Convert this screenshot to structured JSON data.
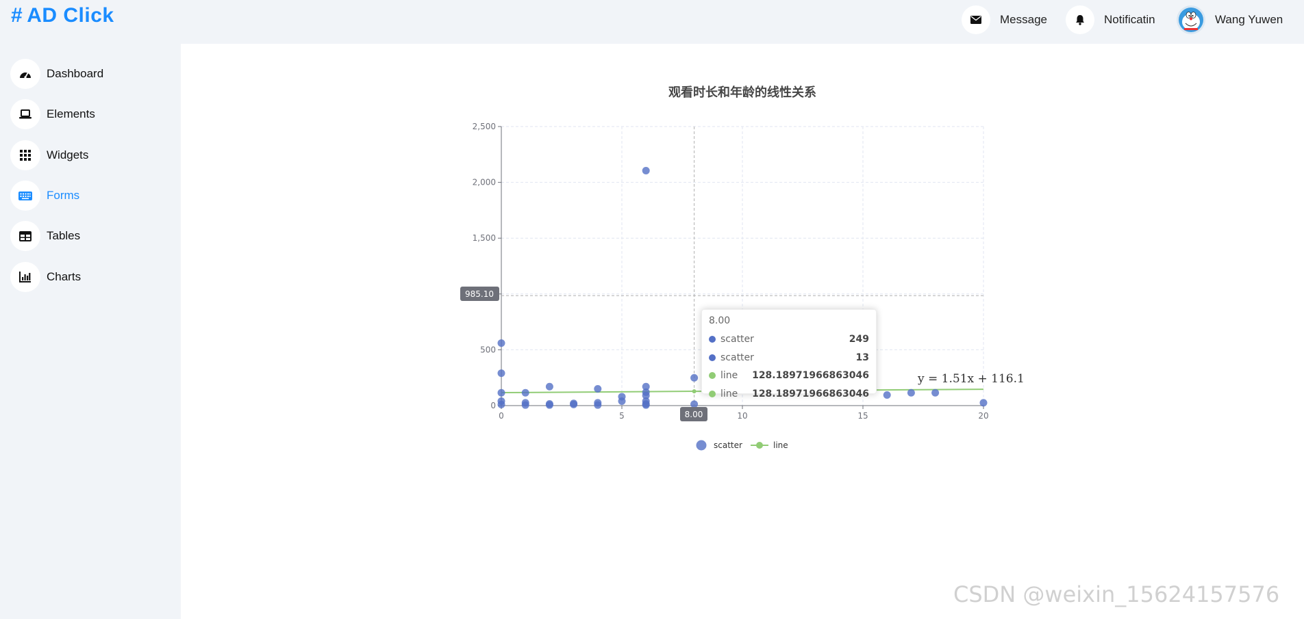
{
  "app": {
    "logo_text": "AD Click",
    "logo_hash": "#"
  },
  "header": {
    "message_label": "Message",
    "notification_label": "Notificatin",
    "user_name": "Wang Yuwen",
    "icons": {
      "message": "envelope-icon",
      "notification": "bell-icon",
      "avatar": "doraemon-avatar"
    }
  },
  "sidebar": {
    "items": [
      {
        "label": "Dashboard",
        "icon": "gauge-icon",
        "active": false
      },
      {
        "label": "Elements",
        "icon": "laptop-icon",
        "active": false
      },
      {
        "label": "Widgets",
        "icon": "grid-icon",
        "active": false
      },
      {
        "label": "Forms",
        "icon": "keyboard-icon",
        "active": true
      },
      {
        "label": "Tables",
        "icon": "table-icon",
        "active": false
      },
      {
        "label": "Charts",
        "icon": "bar-chart-icon",
        "active": false
      }
    ]
  },
  "colors": {
    "accent": "#1a8cff",
    "scatter": "#5470c6",
    "line": "#91cc75"
  },
  "chart_data": {
    "type": "scatter",
    "title": "观看时长和年龄的线性关系",
    "xlim": [
      0,
      20
    ],
    "ylim": [
      0,
      2500
    ],
    "x_ticks": [
      "0",
      "5",
      "10",
      "15",
      "20"
    ],
    "y_ticks": [
      "0",
      "500",
      "1,000",
      "1,500",
      "2,000",
      "2,500"
    ],
    "legend": [
      "scatter",
      "line"
    ],
    "legend_position": "bottom-center",
    "grid": true,
    "regression_label": "y = 1.51x + 116.1",
    "series": [
      {
        "name": "scatter",
        "type": "scatter",
        "points": [
          [
            0,
            560
          ],
          [
            0,
            290
          ],
          [
            0,
            115
          ],
          [
            0,
            40
          ],
          [
            0,
            10
          ],
          [
            1,
            115
          ],
          [
            1,
            25
          ],
          [
            1,
            5
          ],
          [
            2,
            170
          ],
          [
            2,
            15
          ],
          [
            2,
            5
          ],
          [
            3,
            20
          ],
          [
            3,
            10
          ],
          [
            4,
            150
          ],
          [
            4,
            25
          ],
          [
            4,
            5
          ],
          [
            5,
            80
          ],
          [
            5,
            40
          ],
          [
            6,
            2105
          ],
          [
            6,
            170
          ],
          [
            6,
            120
          ],
          [
            6,
            90
          ],
          [
            6,
            40
          ],
          [
            6,
            15
          ],
          [
            6,
            5
          ],
          [
            8,
            249
          ],
          [
            8,
            13
          ],
          [
            16,
            95
          ],
          [
            17,
            115
          ],
          [
            18,
            115
          ],
          [
            20,
            25
          ]
        ]
      },
      {
        "name": "line",
        "type": "line",
        "points": [
          [
            0,
            116.1
          ],
          [
            20,
            146.3
          ]
        ]
      }
    ],
    "axis_pointer": {
      "x_label": "8.00",
      "y_label": "985.10",
      "x": 8.0,
      "y": 985.1
    },
    "tooltip": {
      "header": "8.00",
      "rows": [
        {
          "name": "scatter",
          "value": "249"
        },
        {
          "name": "scatter",
          "value": "13"
        },
        {
          "name": "line",
          "value": "128.18971966863046"
        },
        {
          "name": "line",
          "value": "128.18971966863046"
        }
      ]
    }
  },
  "watermark": "CSDN @weixin_15624157576"
}
